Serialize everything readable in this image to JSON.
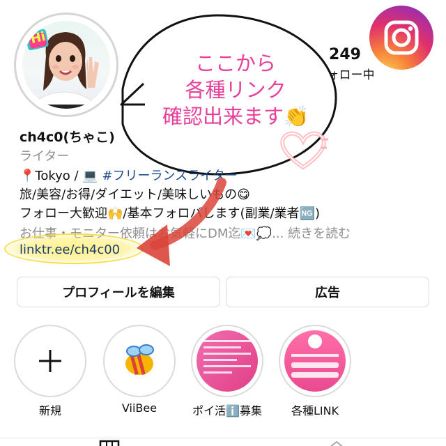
{
  "profile": {
    "username": "ch4c0(ちゃこ)",
    "category": "ライター",
    "bio_line1_a": "📍Tokyo / 💻 ",
    "bio_line1_hashtag": "#フリーランス",
    "bio_line1_b": "ライター",
    "bio_line2": "旅/美容/お得/ダイエット/美味しいもの😋",
    "bio_line3": "フォロー大歓迎🙌/基本フォロバします(副業/業者🆖)",
    "bio_line4": "お仕事・モニター依頼はお気軽にDM迄💌💭... ",
    "more_label": "続きを読む",
    "link": "linktr.ee/ch4c00",
    "avatar_badge": "Hi"
  },
  "stats": {
    "following_count": "249",
    "following_label": "フォロー中"
  },
  "callout": {
    "line1": "ここから",
    "line2": "各種リンク",
    "line3": "確認出来ます👏"
  },
  "buttons": {
    "edit_profile": "プロフィールを編集",
    "ads": "広告"
  },
  "highlights": [
    {
      "label": "新規"
    },
    {
      "label": "ViiBee"
    },
    {
      "label": "ポイ活ℹ️募集"
    },
    {
      "label": "各種LINK"
    }
  ],
  "colors": {
    "link": "#1b3b6e",
    "hashtag": "#1b4a8a",
    "callout_text": "#e8409a",
    "arrow": "#d9453a",
    "highlight_glow": "#f6da3c"
  }
}
